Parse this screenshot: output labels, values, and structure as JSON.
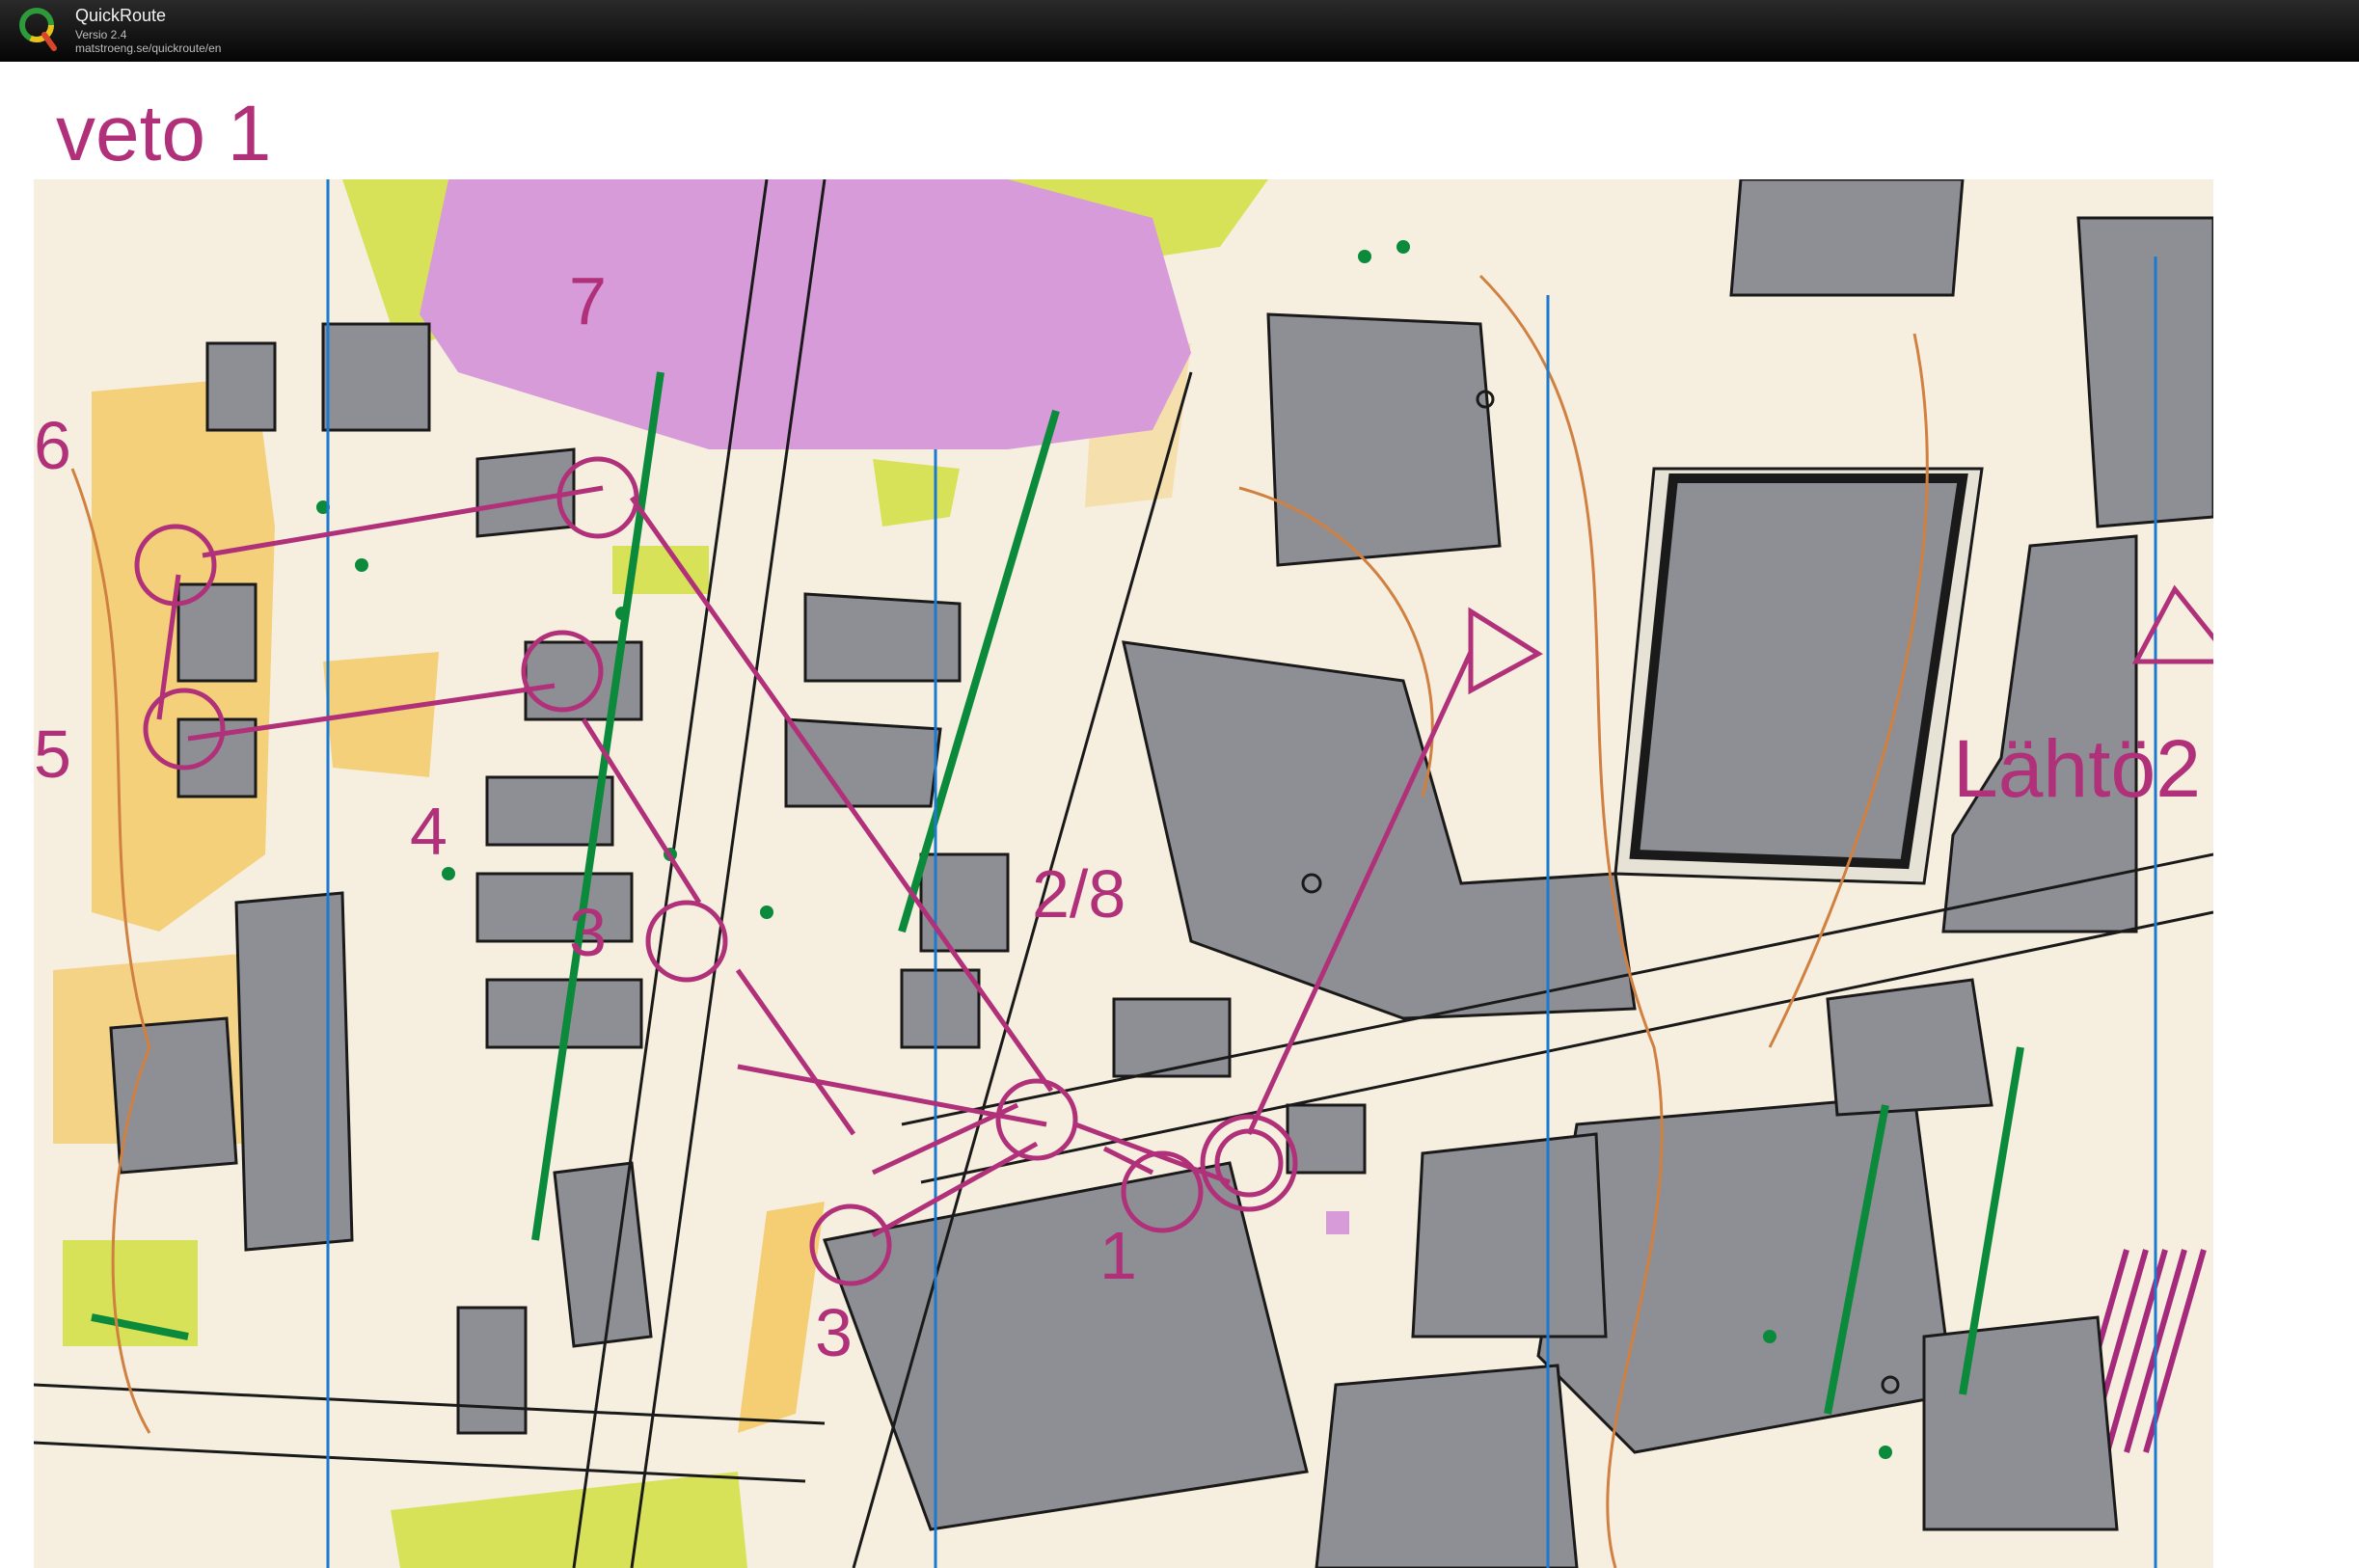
{
  "app": {
    "name": "QuickRoute",
    "version": "Versio 2.4",
    "url": "matstroeng.se/quickroute/en"
  },
  "map": {
    "title": "veto 1",
    "start_label": "Lähtö2",
    "control_labels": [
      "6",
      "7",
      "5",
      "4",
      "3",
      "2/8",
      "1",
      "3"
    ]
  },
  "colors": {
    "course": "#b0307a",
    "building": "#8e8f94",
    "paved": "#f6efdf",
    "grass": "#d8e258",
    "open": "#f4c860",
    "green": "#0a8a3a",
    "water_line": "#1a7ad0",
    "contour": "#d08040",
    "special": "#d79bd9"
  }
}
